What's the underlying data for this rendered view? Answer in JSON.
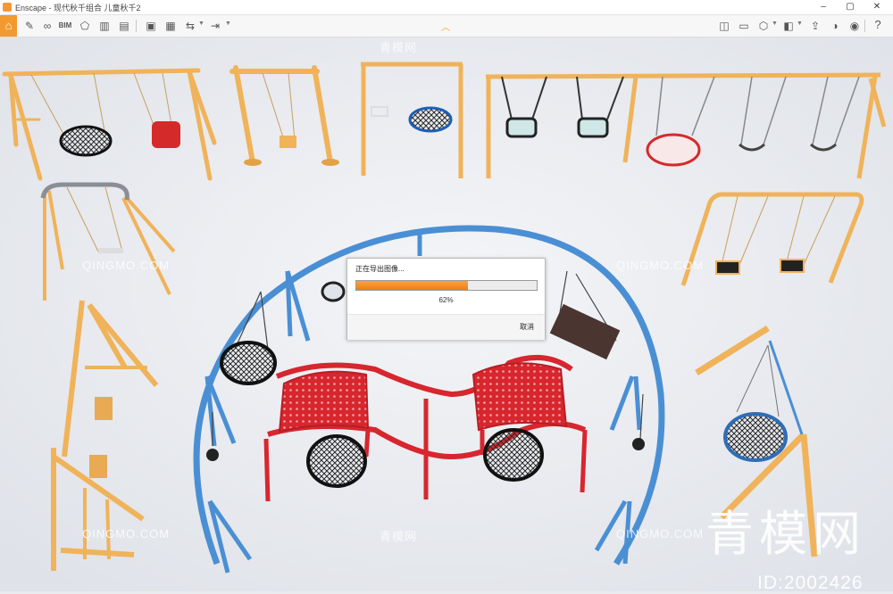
{
  "window": {
    "title": "Enscape - 现代秋千组合 儿童秋千2",
    "controls": {
      "minimize": "–",
      "maximize": "▢",
      "close": "✕"
    }
  },
  "toolbar": {
    "left_icons": [
      "home-icon",
      "brush-icon",
      "link-icon",
      "bim-icon",
      "asset-icon",
      "building-icon",
      "clapper-icon",
      "video-icon",
      "settings-export-icon",
      "batch-icon",
      "export-dropdown-icon"
    ],
    "bim_label": "BIM",
    "right_icons": [
      "views-icon",
      "screenshot-icon",
      "asset-library-icon",
      "material-icon",
      "upload-icon",
      "collaborate-icon",
      "eye-icon",
      "settings-icon",
      "help-icon"
    ],
    "help_label": "?"
  },
  "dialog": {
    "title": "正在导出图像...",
    "progress": 0.62,
    "percent_label": "62%",
    "cancel_label": "取消"
  },
  "watermarks": {
    "site_text": "QINGMO.COM",
    "site_text_cn": "青模网",
    "big_text": "青模网",
    "id_text": "ID:2002426"
  },
  "colors": {
    "accent": "#f29a2e",
    "ring_blue": "#4a8fd4",
    "bench_red": "#e0343c",
    "frame_orange": "#f0b35a",
    "ground": "#e9ebef"
  }
}
